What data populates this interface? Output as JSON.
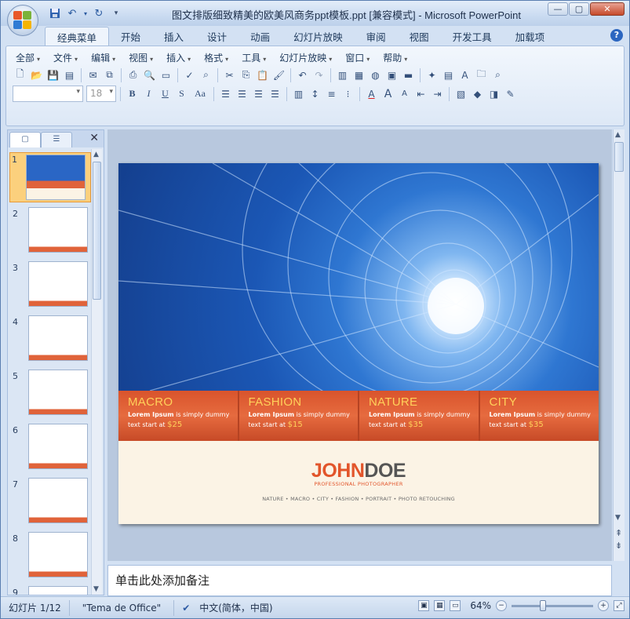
{
  "window": {
    "title": "图文排版细致精美的欧美风商务ppt模板.ppt [兼容模式] - Microsoft PowerPoint",
    "minimize_glyph": "—",
    "maximize_glyph": "▢",
    "close_glyph": "✕"
  },
  "ribbon_tabs": [
    "经典菜单",
    "开始",
    "插入",
    "设计",
    "动画",
    "幻灯片放映",
    "审阅",
    "视图",
    "开发工具",
    "加载项"
  ],
  "help_glyph": "?",
  "classic_menu": [
    "全部",
    "文件",
    "编辑",
    "视图",
    "插入",
    "格式",
    "工具",
    "幻灯片放映",
    "窗口",
    "帮助"
  ],
  "font_size_value": "18",
  "format_buttons": {
    "bold": "B",
    "italic": "I",
    "underline": "U",
    "shadow": "S",
    "case": "Aa"
  },
  "pane": {
    "close_glyph": "✕",
    "slide_numbers": [
      "1",
      "2",
      "3",
      "4",
      "5",
      "6",
      "7",
      "8",
      "9"
    ]
  },
  "slide": {
    "cards": [
      {
        "title": "MACRO",
        "line1_bold": "Lorem Ipsum",
        "line1_rest": " is simply dummy",
        "line2": "text start at ",
        "price": "$25"
      },
      {
        "title": "FASHION",
        "line1_bold": "Lorem Ipsum",
        "line1_rest": " is simply dummy",
        "line2": "text start at ",
        "price": "$15"
      },
      {
        "title": "NATURE",
        "line1_bold": "Lorem Ipsum",
        "line1_rest": " is simply dummy",
        "line2": "text start at ",
        "price": "$35"
      },
      {
        "title": "CITY",
        "line1_bold": "Lorem Ipsum",
        "line1_rest": " is simply dummy",
        "line2": "text start at ",
        "price": "$35"
      }
    ],
    "brand_first": "JOHN",
    "brand_last": "DOE",
    "brand_sub": "PROFESSIONAL PHOTOGRAPHER",
    "tags": "NATURE  •  MACRO  •  CITY  •  FASHION  •  PORTRAIT  •  PHOTO  RETOUCHING"
  },
  "notes_placeholder": "单击此处添加备注",
  "status": {
    "slide_counter": "幻灯片 1/12",
    "theme": "\"Tema de Office\"",
    "language": "中文(简体，中国)",
    "zoom": "64%"
  },
  "colors": {
    "accent_orange": "#e2552b",
    "price_yellow": "#ffd15a",
    "hero_blue": "#1b57b5"
  }
}
